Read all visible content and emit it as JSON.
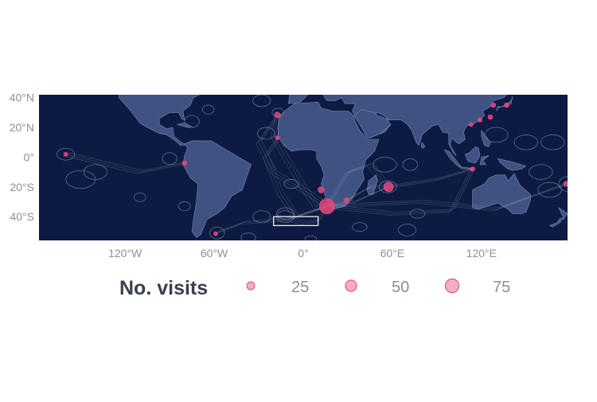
{
  "map": {
    "background_color": "#0d1b42",
    "land_color": "#3f5282",
    "border_color": "#7a8cb8",
    "eez_color": "#5b6b96",
    "track_color": "#b9bfd6",
    "point_color": "#e8467c",
    "highlight_box_color": "#ffffff",
    "lon_ticks": [
      {
        "value": -120,
        "label": "120°W"
      },
      {
        "value": -60,
        "label": "60°W"
      },
      {
        "value": 0,
        "label": "0°"
      },
      {
        "value": 60,
        "label": "60°E"
      },
      {
        "value": 120,
        "label": "120°E"
      }
    ],
    "lat_ticks": [
      {
        "value": 40,
        "label": "40°N"
      },
      {
        "value": 20,
        "label": "20°N"
      },
      {
        "value": 0,
        "label": "0°"
      },
      {
        "value": -20,
        "label": "20°S"
      },
      {
        "value": -40,
        "label": "40°S"
      }
    ],
    "lon_range": [
      -178,
      178
    ],
    "lat_range": [
      -56,
      42
    ],
    "highlight_box": {
      "lon": [
        -20,
        10
      ],
      "lat": [
        -46,
        -40
      ]
    },
    "visit_points": [
      {
        "lon": 16,
        "lat": -33,
        "visits": 75
      },
      {
        "lon": 57.5,
        "lat": -20,
        "visits": 30
      },
      {
        "lon": 12,
        "lat": -22,
        "visits": 12
      },
      {
        "lon": 29,
        "lat": -29,
        "visits": 8
      },
      {
        "lon": -17.5,
        "lat": 28.5,
        "visits": 10
      },
      {
        "lon": -17.5,
        "lat": 13,
        "visits": 5
      },
      {
        "lon": -160,
        "lat": 2,
        "visits": 5
      },
      {
        "lon": -80,
        "lat": -4,
        "visits": 6
      },
      {
        "lon": -59,
        "lat": -51.5,
        "visits": 5
      },
      {
        "lon": 114,
        "lat": -8,
        "visits": 6
      },
      {
        "lon": 126,
        "lat": 27,
        "visits": 7
      },
      {
        "lon": 119,
        "lat": 25,
        "visits": 6
      },
      {
        "lon": 113,
        "lat": 22,
        "visits": 5
      },
      {
        "lon": 128,
        "lat": 35,
        "visits": 7
      },
      {
        "lon": 137,
        "lat": 35,
        "visits": 7
      },
      {
        "lon": 177,
        "lat": -18,
        "visits": 8
      }
    ]
  },
  "legend": {
    "title": "No. visits",
    "entries": [
      {
        "value": 25,
        "label": "25"
      },
      {
        "value": 50,
        "label": "50"
      },
      {
        "value": 75,
        "label": "75"
      }
    ]
  }
}
